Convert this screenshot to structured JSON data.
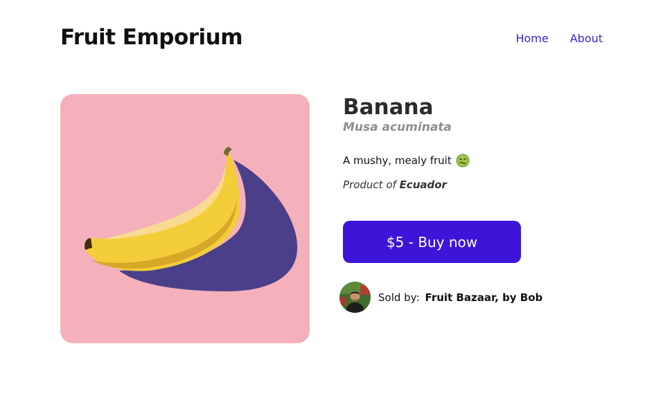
{
  "header": {
    "site_title": "Fruit Emporium",
    "nav": [
      {
        "label": "Home"
      },
      {
        "label": "About"
      }
    ],
    "link_color": "#3d21d1"
  },
  "product": {
    "name": "Banana",
    "latin_name": "Musa acuminata",
    "description": "A mushy, mealy fruit",
    "description_icon": "nauseated-face-icon",
    "origin_prefix": "Product of",
    "origin_country": "Ecuador",
    "image_background": "#f5b1bb"
  },
  "buy_button": {
    "price": "$5",
    "separator": " - ",
    "label": "Buy now",
    "color": "#3d15d9"
  },
  "seller": {
    "label": "Sold by:",
    "name": "Fruit Bazaar, by Bob"
  }
}
